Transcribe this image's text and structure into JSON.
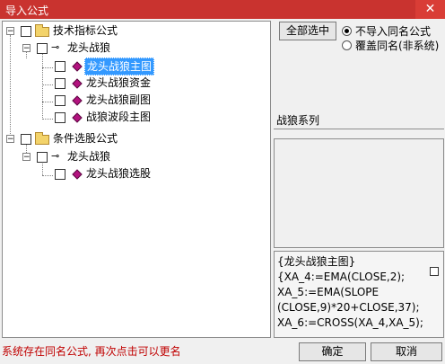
{
  "window": {
    "title": "导入公式",
    "close_label": "✕"
  },
  "tree": {
    "group1": {
      "label": "技术指标公式",
      "expander": "−"
    },
    "set1": {
      "label": "龙头战狼",
      "expander": "−"
    },
    "items1": [
      "龙头战狼主图",
      "龙头战狼资金",
      "龙头战狼副图",
      "战狼波段主图"
    ],
    "group2": {
      "label": "条件选股公式",
      "expander": "−"
    },
    "set2": {
      "label": "龙头战狼",
      "expander": "−"
    },
    "items2": [
      "龙头战狼选股"
    ],
    "selected_item": "龙头战狼主图"
  },
  "right": {
    "select_all_label": "全部选中",
    "radio_options": [
      "不导入同名公式",
      "覆盖同名(非系统)"
    ],
    "radio_selected": "不导入同名公式",
    "series_label": "战狼系列",
    "code_lines": [
      "{龙头战狼主图}",
      "{XA_4:=EMA(CLOSE,2);",
      "XA_5:=EMA(SLOPE",
      "(CLOSE,9)*20+CLOSE,37);",
      "XA_6:=CROSS(XA_4,XA_5);"
    ]
  },
  "footer": {
    "status": "系统存在同名公式, 再次点击可以更名",
    "ok_label": "确定",
    "cancel_label": "取消"
  }
}
